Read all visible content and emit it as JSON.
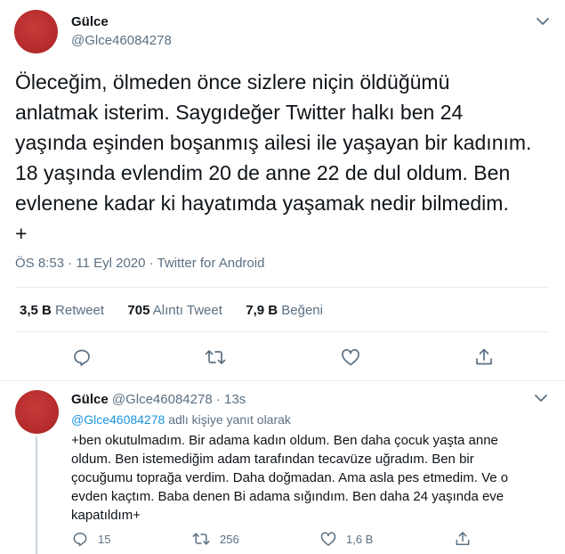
{
  "main_tweet": {
    "author_name": "Gülce",
    "author_handle": "@Glce46084278",
    "text_lines": [
      "Öleceğim, ölmeden önce sizlere niçin öldüğümü",
      "anlatmak isterim. Saygıdeğer Twitter halkı ben 24",
      "yaşında eşinden boşanmış ailesi ile yaşayan bir kadınım.",
      "18 yaşında evlendim 20 de anne 22 de dul oldum. Ben",
      "evlenene kadar ki hayatımda yaşamak nedir bilmedim.",
      "+"
    ],
    "timestamp": "ÖS 8:53 · 11 Eyl 2020 · Twitter for Android",
    "stats": {
      "retweets_value": "3,5 B",
      "retweets_label": "Retweet",
      "quotes_value": "705",
      "quotes_label": "Alıntı Tweet",
      "likes_value": "7,9 B",
      "likes_label": "Beğeni"
    }
  },
  "reply_tweet": {
    "author_name": "Gülce",
    "author_handle": "@Glce46084278",
    "time_ago": "· 13s",
    "replying_to_handle": "@Glce46084278",
    "replying_to_suffix": "adlı kişiye yanıt olarak",
    "text_lines": [
      "+ben okutulmadım. Bir adama kadın oldum. Ben daha çocuk yaşta anne",
      "oldum. Ben istemediğim adam tarafından tecavüze uğradım. Ben bir",
      "çocuğumu toprağa verdim. Daha doğmadan. Ama asla pes etmedim. Ve o",
      "evden kaçtım. Baba denen Bi adama sığındım. Ben daha 24 yaşında eve",
      "kapatıldım+"
    ],
    "reply_count": "15",
    "retweet_count": "256",
    "like_count": "1,6 B"
  },
  "colors": {
    "accent": "#1b95e0",
    "secondary_text": "#5b7083",
    "divider": "#e6ecf0",
    "avatar": "#b72c2c"
  },
  "icons": [
    "chevron-down-icon",
    "reply-icon",
    "retweet-icon",
    "like-icon",
    "share-icon"
  ]
}
